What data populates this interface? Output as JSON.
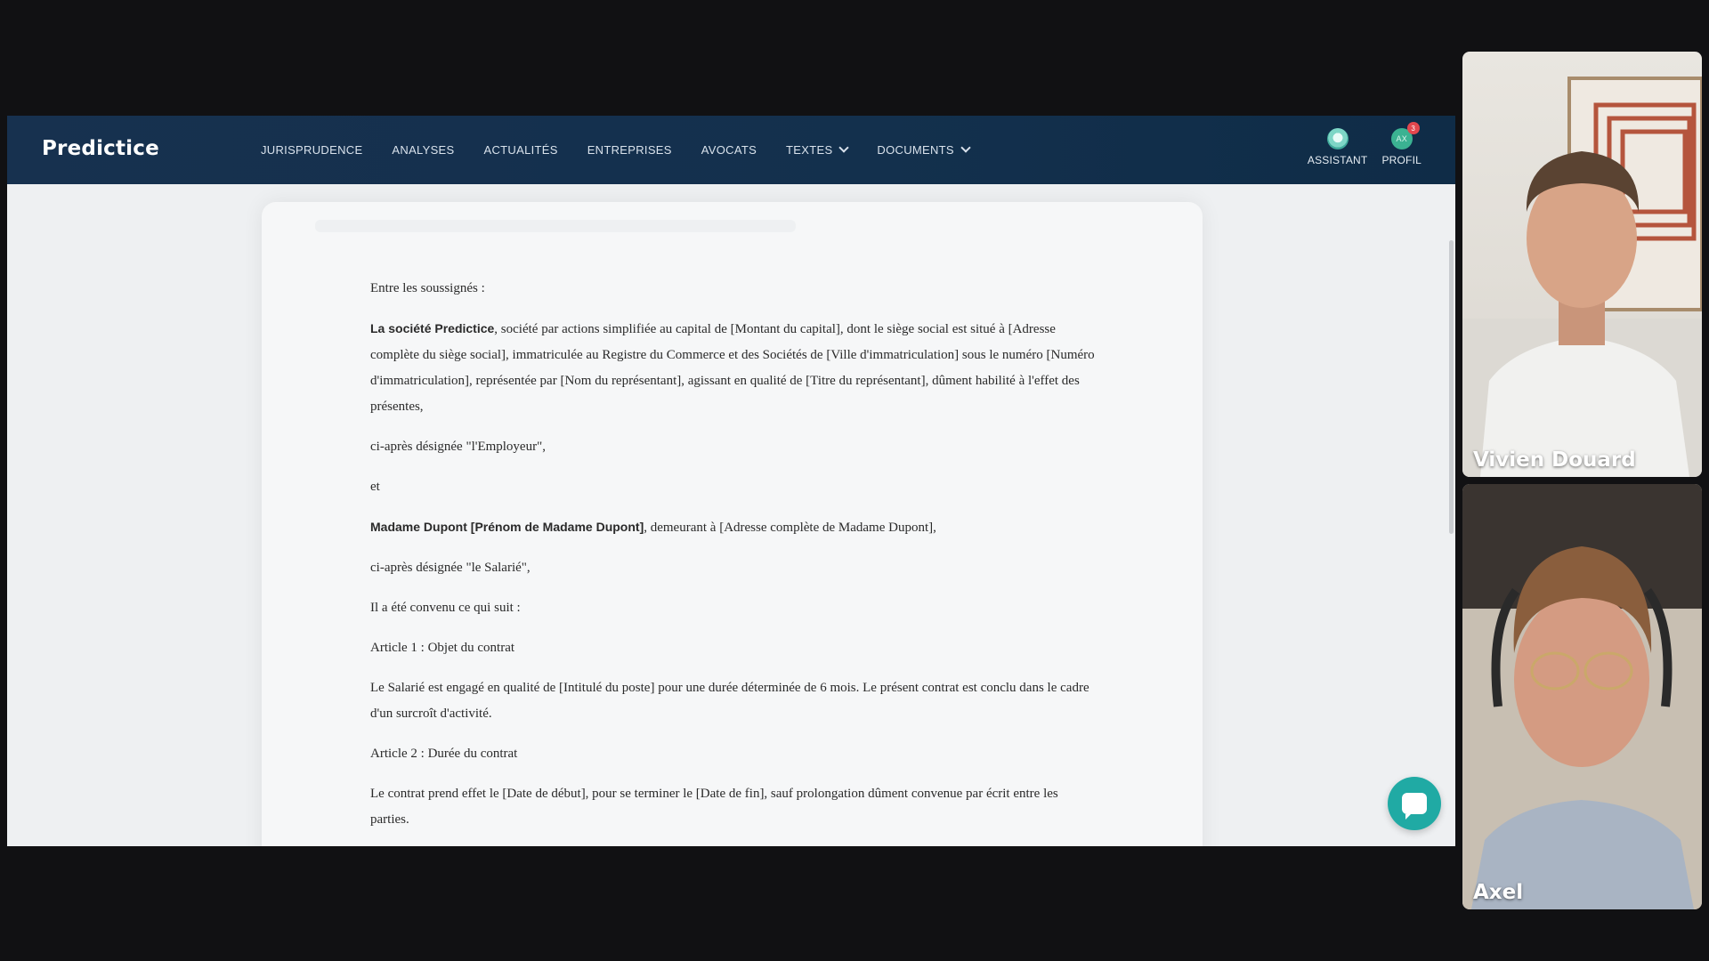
{
  "app": {
    "logo": "Predictice",
    "nav": [
      {
        "label": "JURISPRUDENCE"
      },
      {
        "label": "ANALYSES"
      },
      {
        "label": "ACTUALITÉS"
      },
      {
        "label": "ENTREPRISES"
      },
      {
        "label": "AVOCATS"
      },
      {
        "label": "TEXTES",
        "dropdown": true
      },
      {
        "label": "DOCUMENTS",
        "dropdown": true
      }
    ],
    "assistant_label": "ASSISTANT",
    "profile_label": "PROFIL",
    "profile_initials": "AX",
    "notification_count": "3"
  },
  "document": {
    "p1": "Entre les soussignés :",
    "p2_bold": "La société Predictice",
    "p2_rest": ", société par actions simplifiée au capital de [Montant du capital], dont le siège social est situé à [Adresse complète du siège social], immatriculée au Registre du Commerce et des Sociétés de [Ville d'immatriculation] sous le numéro [Numéro d'immatriculation], représentée par [Nom du représentant], agissant en qualité de [Titre du représentant], dûment habilité à l'effet des présentes,",
    "p3": "ci-après désignée \"l'Employeur\",",
    "p4": "et",
    "p5_bold": "Madame Dupont [Prénom de Madame Dupont]",
    "p5_rest": ", demeurant à [Adresse complète de Madame Dupont],",
    "p6": "ci-après désignée \"le Salarié\",",
    "p7": "Il a été convenu ce qui suit :",
    "p8": "Article 1 : Objet du contrat",
    "p9": "Le Salarié est engagé en qualité de [Intitulé du poste] pour une durée déterminée de 6 mois. Le présent contrat est conclu dans le cadre d'un surcroît d'activité.",
    "p10": "Article 2 : Durée du contrat",
    "p11": "Le contrat prend effet le [Date de début], pour se terminer le [Date de fin], sauf prolongation dûment convenue par écrit entre les parties."
  },
  "participants": [
    {
      "name": "Vivien Douard"
    },
    {
      "name": "Axel"
    }
  ],
  "colors": {
    "navbar": "#13304d",
    "chat_button": "#20aaa4",
    "badge": "#e2474e"
  }
}
